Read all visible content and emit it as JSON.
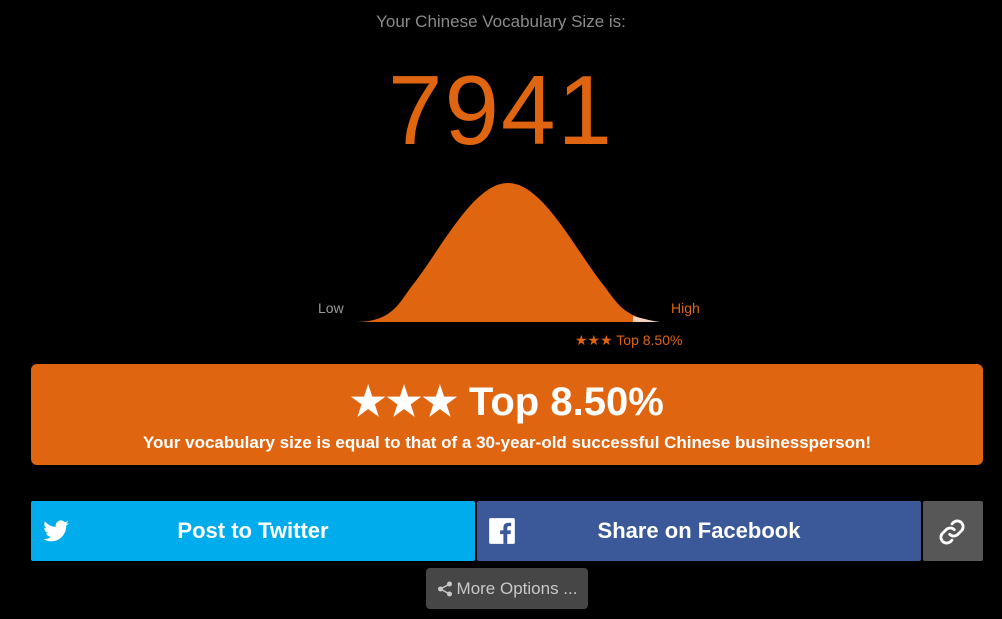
{
  "result": {
    "heading": "Your Chinese Vocabulary Size is:",
    "score": "7941"
  },
  "distribution": {
    "low_label": "Low",
    "high_label": "High",
    "rank_label": "★★★ Top 8.50%",
    "top_percent": 8.5,
    "fill_color": "#df6510"
  },
  "banner": {
    "rank": "★★★ Top 8.50%",
    "description": "Your vocabulary size is equal to that of a 30-year-old successful Chinese businessperson!"
  },
  "share": {
    "twitter_label": "Post to Twitter",
    "facebook_label": "Share on Facebook",
    "more_options_label": "More Options ...",
    "twitter_color": "#00acec",
    "facebook_color": "#3b5998",
    "icons": [
      "twitter-icon",
      "facebook-icon",
      "link-icon",
      "share-icon"
    ]
  }
}
